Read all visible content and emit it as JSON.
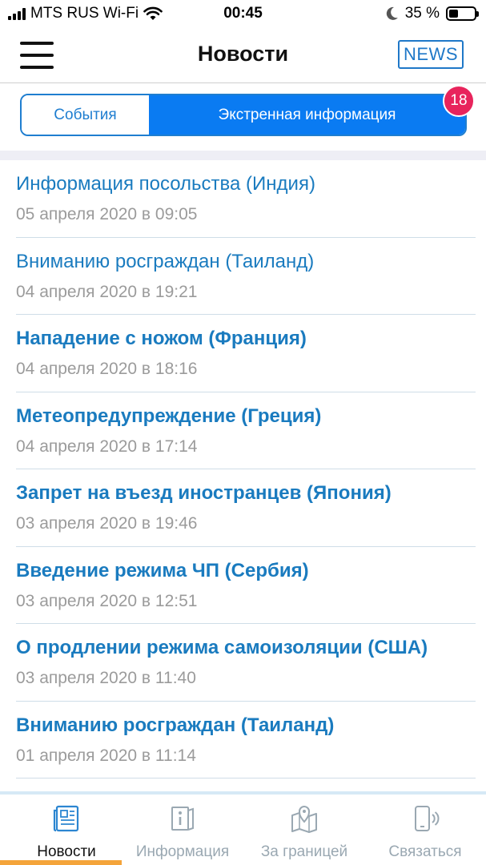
{
  "status_bar": {
    "carrier": "MTS RUS Wi-Fi",
    "time": "00:45",
    "battery": "35 %",
    "battery_level": 0.35
  },
  "header": {
    "title": "Новости",
    "logo_text": "NEWS"
  },
  "segmented": {
    "events_label": "События",
    "emergency_label": "Экстренная информация",
    "badge_count": "18"
  },
  "news": [
    {
      "title": "Информация посольства (Индия)",
      "date": "05 апреля 2020 в 09:05",
      "bold": false
    },
    {
      "title": "Вниманию росграждан (Таиланд)",
      "date": "04 апреля 2020 в 19:21",
      "bold": false
    },
    {
      "title": "Нападение с ножом (Франция)",
      "date": "04 апреля 2020 в 18:16",
      "bold": true
    },
    {
      "title": "Метеопредупреждение (Греция)",
      "date": "04 апреля 2020 в 17:14",
      "bold": true
    },
    {
      "title": "Запрет на въезд иностранцев (Япония)",
      "date": "03 апреля 2020 в 19:46",
      "bold": true
    },
    {
      "title": "Введение режима ЧП (Сербия)",
      "date": "03 апреля 2020 в 12:51",
      "bold": true
    },
    {
      "title": "О продлении режима самоизоляции (США)",
      "date": "03 апреля 2020 в 11:40",
      "bold": true
    },
    {
      "title": "Вниманию росграждан (Таиланд)",
      "date": "01 апреля 2020 в 11:14",
      "bold": true
    }
  ],
  "tabs": [
    {
      "label": "Новости",
      "icon": "newspaper-icon",
      "active": true
    },
    {
      "label": "Информация",
      "icon": "info-book-icon",
      "active": false
    },
    {
      "label": "За границей",
      "icon": "map-pin-icon",
      "active": false
    },
    {
      "label": "Связаться",
      "icon": "phone-contact-icon",
      "active": false
    }
  ],
  "colors": {
    "accent": "#0a7bf2",
    "link": "#1a7bbf",
    "badge": "#e8245c",
    "tab_indicator": "#f4a43a"
  }
}
